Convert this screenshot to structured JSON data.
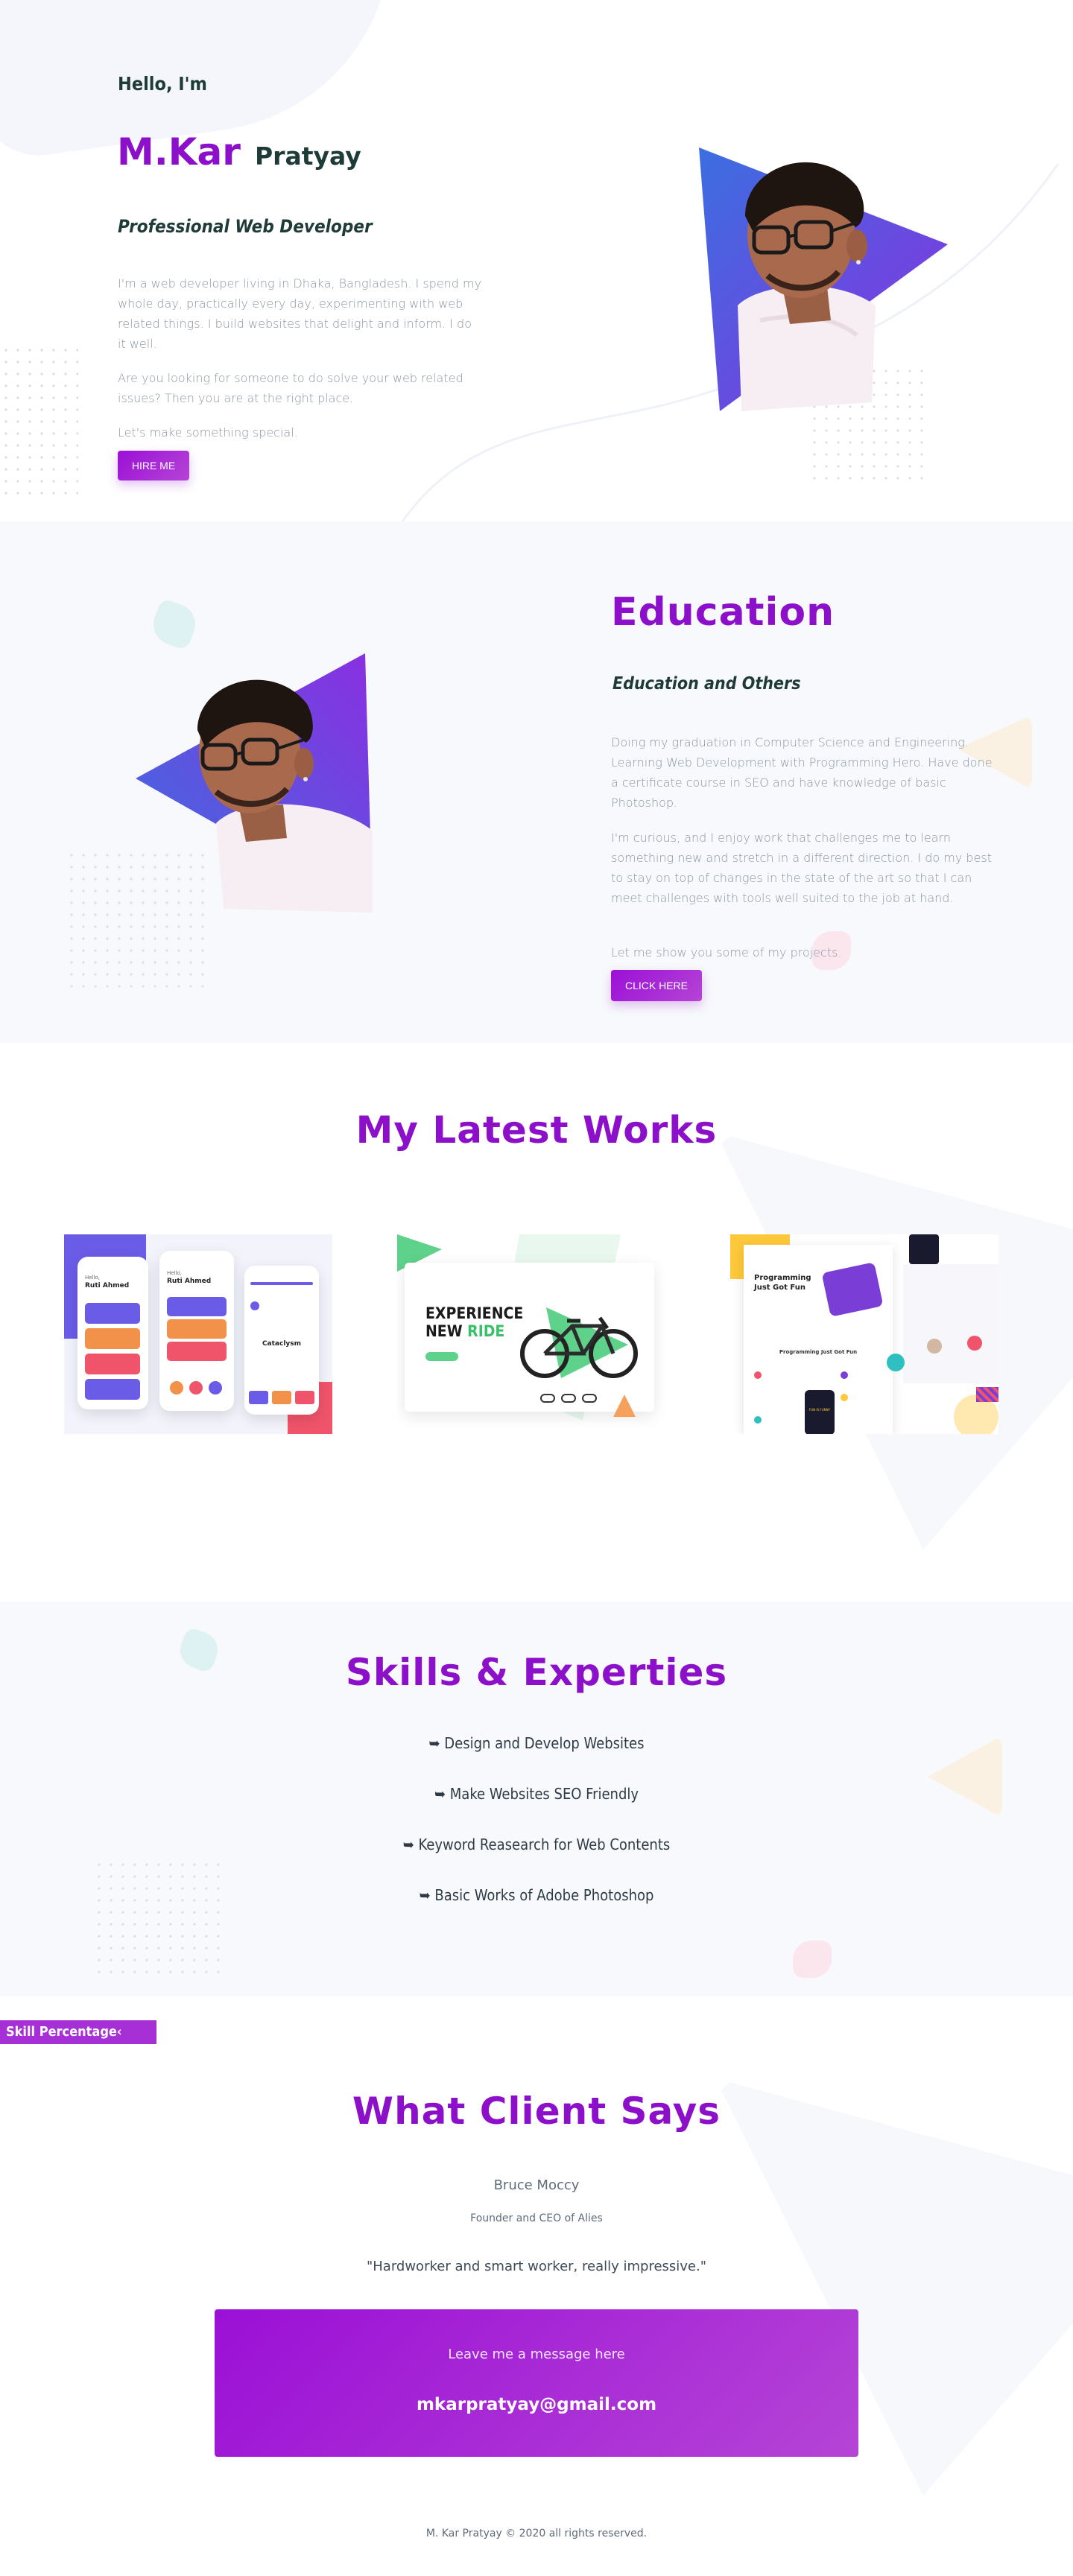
{
  "hero": {
    "greeting": "Hello, I'm",
    "name_first": "M.Kar",
    "name_last": "Pratyay",
    "role": "Professional Web Developer",
    "para1": "I'm a web developer living in Dhaka, Bangladesh. I spend my whole day, practically every day, experimenting with web related things. I build websites that delight and inform. I do it well.",
    "para2": "Are you looking for someone to do solve your web related issues? Then you are at the right place.",
    "para3": "Let's make something special.",
    "button": "HIRE ME"
  },
  "education": {
    "title": "Education",
    "subtitle": "Education and Others",
    "para1": "Doing my graduation in Computer Science and Engineering. Learning Web Development with Programming Hero. Have done a certificate course in SEO and have knowledge of basic Photoshop.",
    "para2": "I'm curious, and I enjoy work that challenges me to learn something new and stretch in a different direction. I do my best to stay on top of changes in the state of the art so that I can meet challenges with tools well suited to the job at hand.",
    "para3": "Let me show you some of my projects.",
    "button": "CLICK HERE"
  },
  "works": {
    "title": "My Latest Works",
    "card1": {
      "greet_a": "Hello,",
      "name_a": "Ruti Ahmed",
      "greet_b": "Hello,",
      "name_b": "Ruti Ahmed",
      "label": "Cataclysm"
    },
    "card2": {
      "headline_a": "EXPERIENCE",
      "headline_b": "NEW",
      "headline_c": "RIDE"
    },
    "card3": {
      "headline": "Programming Just Got Fun",
      "section": "Programming Just Got Fun",
      "badge": "FUN IS FUNNY"
    }
  },
  "skills": {
    "title": "Skills & Experties",
    "items": [
      "➥ Design and Develop Websites",
      "➥ Make Websites SEO Friendly",
      "➥ Keyword Reasearch for Web Contents",
      "➥ Basic Works of Adobe Photoshop"
    ],
    "tab_label": "Skill Percentage‹"
  },
  "client": {
    "title": "What Client Says",
    "name": "Bruce Moccy",
    "position": "Founder and CEO of Alies",
    "quote": "\"Hardworker and smart worker, really impressive.\""
  },
  "contact": {
    "prompt": "Leave me a message here",
    "email": "mkarpratyay@gmail.com"
  },
  "footer": {
    "text": "M. Kar Pratyay © 2020 all rights reserved."
  },
  "colors": {
    "accent": "#8c10c9",
    "section_bg": "#f8f9fc",
    "dark_text": "#1f3b38"
  }
}
